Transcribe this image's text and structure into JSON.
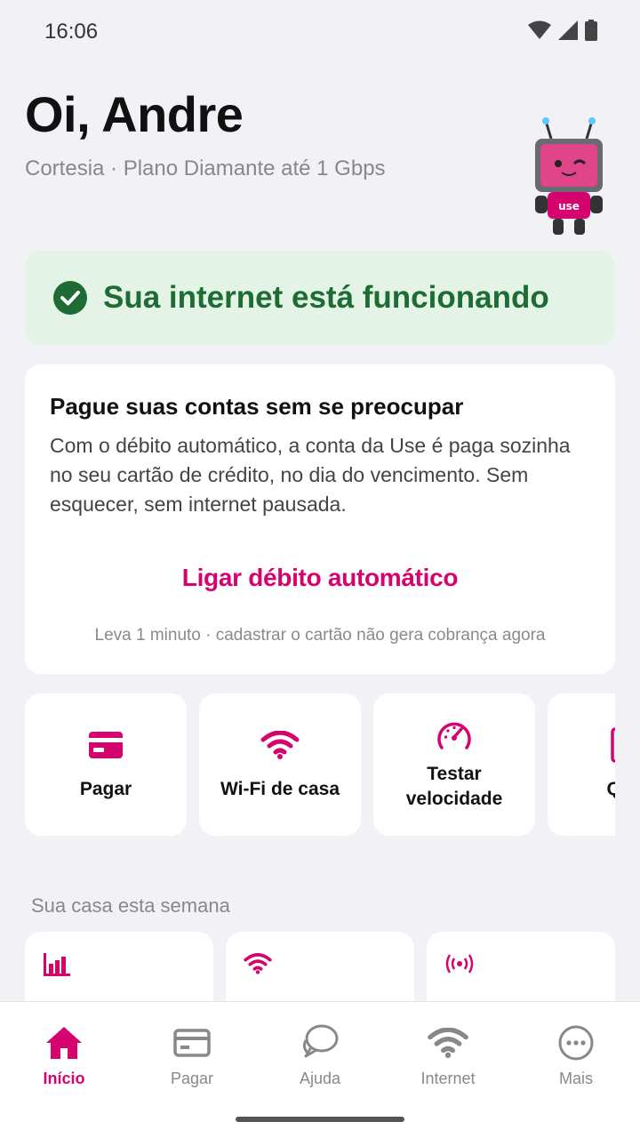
{
  "status_bar": {
    "time": "16:06"
  },
  "header": {
    "greeting": "Oi, Andre",
    "plan": "Cortesia · Plano Diamante até 1 Gbps",
    "mascot_badge": "use"
  },
  "connection_status": {
    "message": "Sua internet está funcionando",
    "color": "#1e6b33",
    "background": "#e3f4e6"
  },
  "debit_card": {
    "title": "Pague suas contas sem se preocupar",
    "body": "Com o débito automático, a conta da Use é paga sozinha no seu cartão de crédito, no dia do vencimento. Sem esquecer, sem internet pausada.",
    "action": "Ligar débito automático",
    "note": "Leva 1 minuto · cadastrar o cartão não gera cobrança agora"
  },
  "quick_actions": [
    {
      "label": "Pagar",
      "icon": "credit-card-icon"
    },
    {
      "label": "Wi-Fi de casa",
      "icon": "wifi-icon"
    },
    {
      "label": "Testar velocidade",
      "icon": "speedometer-icon"
    },
    {
      "label": "Quar",
      "icon": "partial-icon"
    }
  ],
  "week": {
    "title": "Sua casa esta semana",
    "cards": [
      {
        "icon": "bar-chart-icon"
      },
      {
        "icon": "wifi-icon"
      },
      {
        "icon": "signal-broadcast-icon"
      }
    ]
  },
  "bottom_nav": [
    {
      "label": "Início",
      "icon": "home-icon",
      "active": true
    },
    {
      "label": "Pagar",
      "icon": "credit-card-icon",
      "active": false
    },
    {
      "label": "Ajuda",
      "icon": "chat-bubbles-icon",
      "active": false
    },
    {
      "label": "Internet",
      "icon": "wifi-icon",
      "active": false
    },
    {
      "label": "Mais",
      "icon": "more-dots-icon",
      "active": false
    }
  ],
  "colors": {
    "accent": "#d6036f",
    "background": "#f2f1f6",
    "inactive": "#888888"
  }
}
